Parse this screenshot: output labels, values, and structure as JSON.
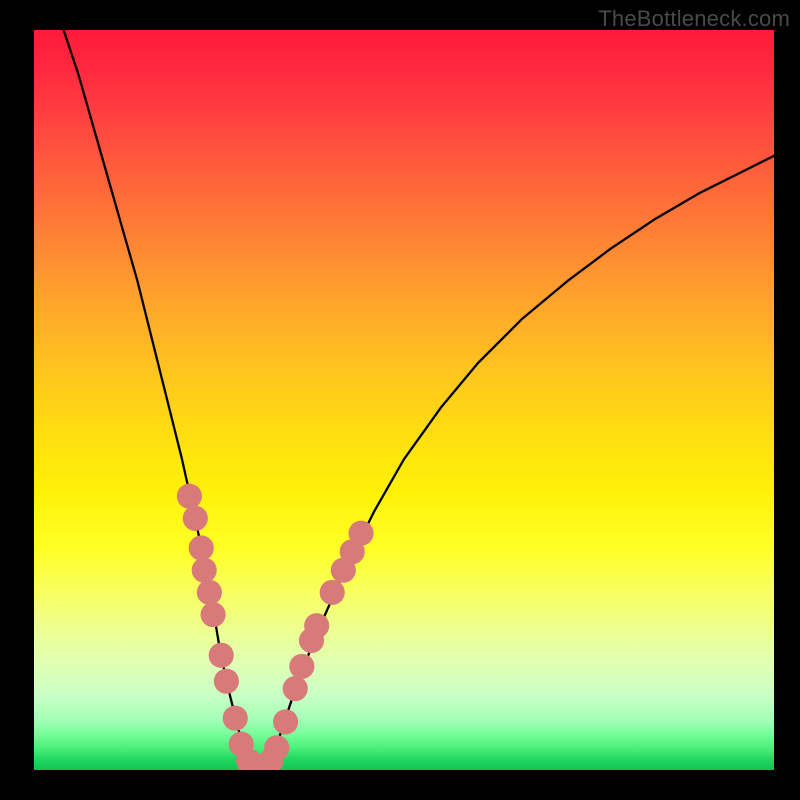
{
  "watermark": "TheBottleneck.com",
  "chart_data": {
    "type": "line",
    "title": "",
    "xlabel": "",
    "ylabel": "",
    "xlim": [
      0,
      100
    ],
    "ylim": [
      0,
      100
    ],
    "curve": {
      "name": "bottleneck-curve",
      "x": [
        4,
        6,
        8,
        10,
        12,
        14,
        16,
        18,
        20,
        22,
        24,
        25,
        26,
        27,
        28,
        29,
        30,
        31,
        32,
        33,
        35,
        38,
        42,
        46,
        50,
        55,
        60,
        66,
        72,
        78,
        84,
        90,
        96,
        100
      ],
      "y": [
        100,
        94,
        87,
        80,
        73,
        66,
        58,
        50,
        42,
        33,
        23,
        17,
        12,
        8,
        4,
        1.5,
        0.4,
        0.4,
        1.5,
        4,
        10,
        18,
        27,
        35,
        42,
        49,
        55,
        61,
        66,
        70.5,
        74.5,
        78,
        81,
        83
      ]
    },
    "marker_series": {
      "name": "highlighted-points",
      "color": "#d97a7a",
      "radius_pct": 1.7,
      "points": [
        {
          "x": 21.0,
          "y": 37.0
        },
        {
          "x": 21.8,
          "y": 34.0
        },
        {
          "x": 22.6,
          "y": 30.0
        },
        {
          "x": 23.0,
          "y": 27.0
        },
        {
          "x": 23.7,
          "y": 24.0
        },
        {
          "x": 24.2,
          "y": 21.0
        },
        {
          "x": 25.3,
          "y": 15.5
        },
        {
          "x": 26.0,
          "y": 12.0
        },
        {
          "x": 27.2,
          "y": 7.0
        },
        {
          "x": 28.0,
          "y": 3.5
        },
        {
          "x": 29.0,
          "y": 1.2
        },
        {
          "x": 30.0,
          "y": 0.5
        },
        {
          "x": 31.0,
          "y": 0.5
        },
        {
          "x": 32.0,
          "y": 1.2
        },
        {
          "x": 32.8,
          "y": 3.0
        },
        {
          "x": 34.0,
          "y": 6.5
        },
        {
          "x": 35.3,
          "y": 11.0
        },
        {
          "x": 36.2,
          "y": 14.0
        },
        {
          "x": 37.5,
          "y": 17.5
        },
        {
          "x": 38.2,
          "y": 19.5
        },
        {
          "x": 40.3,
          "y": 24.0
        },
        {
          "x": 41.8,
          "y": 27.0
        },
        {
          "x": 43.0,
          "y": 29.5
        },
        {
          "x": 44.2,
          "y": 32.0
        }
      ]
    }
  }
}
